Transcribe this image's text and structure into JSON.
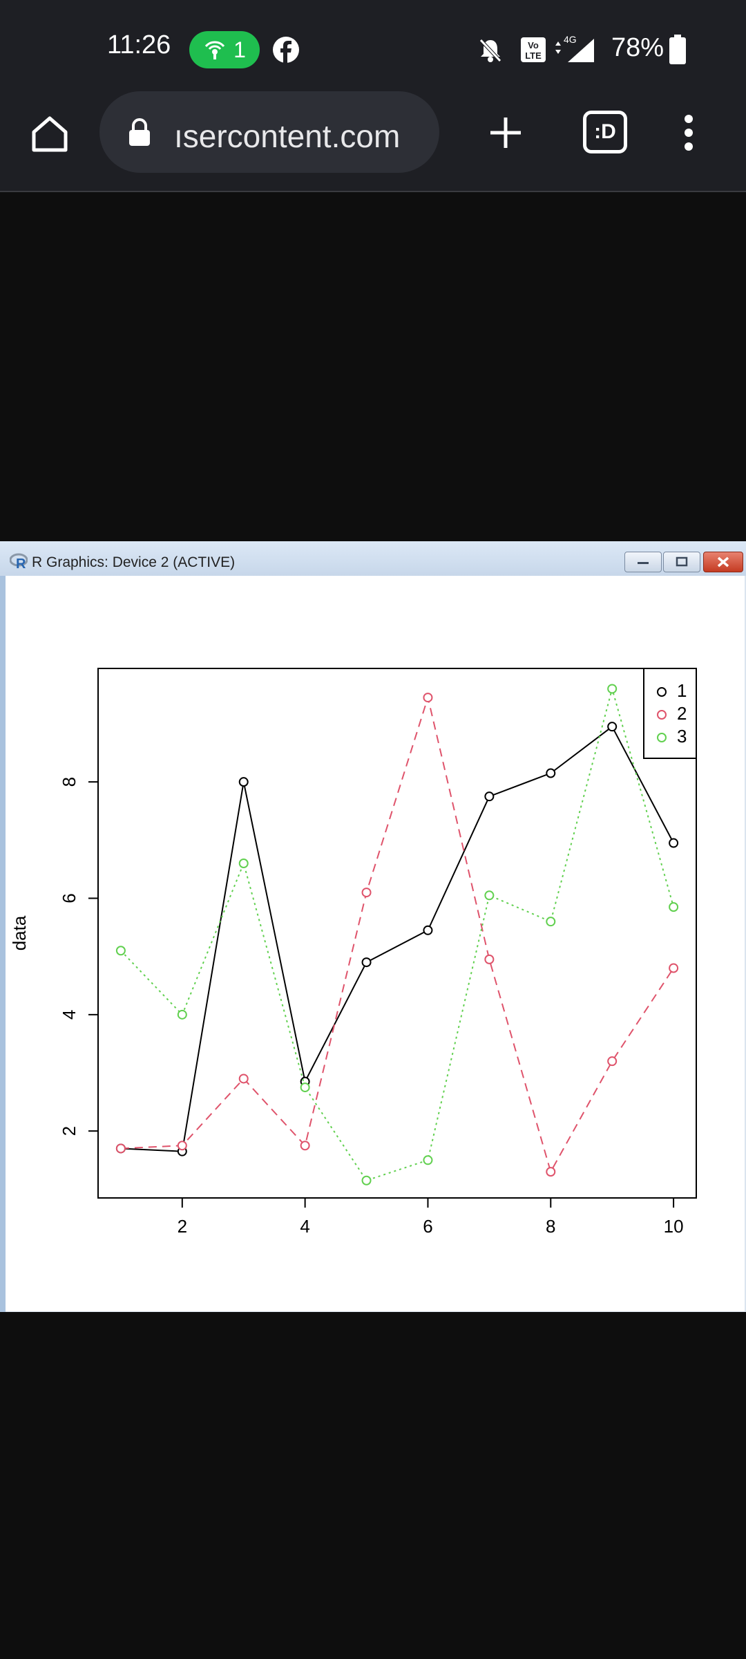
{
  "status_bar": {
    "time": "11:26",
    "hotspot_count": "1",
    "battery": "78%",
    "network": "4G"
  },
  "browser": {
    "url": "ısercontent.com",
    "tab_count_label": ":D"
  },
  "r_window": {
    "title": "R Graphics: Device 2 (ACTIVE)"
  },
  "chart_data": {
    "type": "line",
    "ylabel": "data",
    "xlabel": "",
    "x": [
      1,
      2,
      3,
      4,
      5,
      6,
      7,
      8,
      9,
      10
    ],
    "xticks": [
      2,
      4,
      6,
      8,
      10
    ],
    "yticks": [
      2,
      4,
      6,
      8
    ],
    "xlim": [
      0.63,
      10.37
    ],
    "ylim": [
      0.85,
      9.95
    ],
    "legend_position": "top-right",
    "series": [
      {
        "name": "1",
        "color": "#000000",
        "dash": "solid",
        "values": [
          1.7,
          1.65,
          8.0,
          2.85,
          4.9,
          5.45,
          7.75,
          8.15,
          8.95,
          6.95
        ]
      },
      {
        "name": "2",
        "color": "#df536b",
        "dash": "dashed",
        "values": [
          1.7,
          1.75,
          2.9,
          1.75,
          6.1,
          9.45,
          4.95,
          1.3,
          3.2,
          4.8
        ]
      },
      {
        "name": "3",
        "color": "#61d04f",
        "dash": "dotted",
        "values": [
          5.1,
          4.0,
          6.6,
          2.75,
          1.15,
          1.5,
          6.05,
          5.6,
          9.6,
          5.85
        ]
      }
    ]
  }
}
